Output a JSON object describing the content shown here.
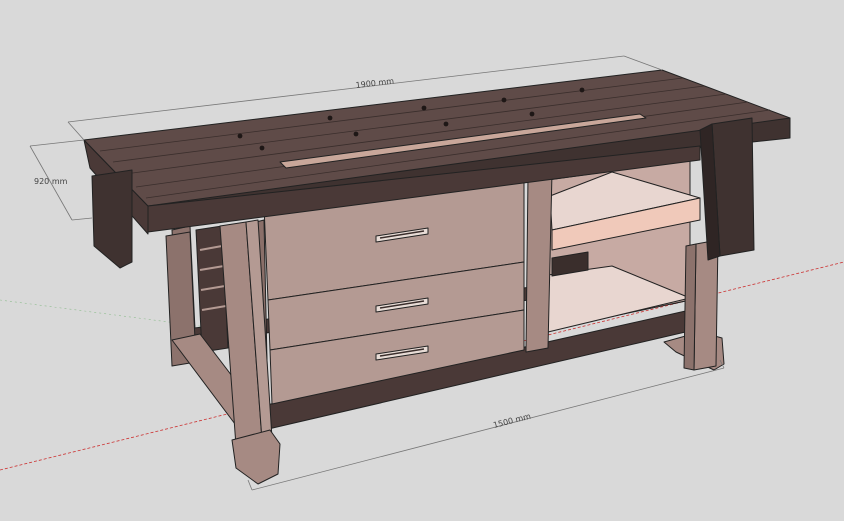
{
  "scene": {
    "background": "#d9d9d9",
    "subject": "workbench",
    "dimensions": {
      "length_top": "1900 mm",
      "height_top": "920 mm",
      "length_base": "1500 mm"
    },
    "colors": {
      "top_surface": "#5f4b48",
      "top_edge": "#3f3230",
      "frame_dark": "#4a3937",
      "leg_light": "#a68a83",
      "leg_shadow": "#8c726c",
      "drawer_face": "#b49a93",
      "drawer_edge": "#8a6f69",
      "shelf": "#e8d6d0",
      "handle": "#e8dcd6",
      "axis_red": "#cc3333",
      "axis_green": "#4aa24a",
      "axis_blue": "#4a5fcc"
    },
    "drawer_count": 3
  }
}
